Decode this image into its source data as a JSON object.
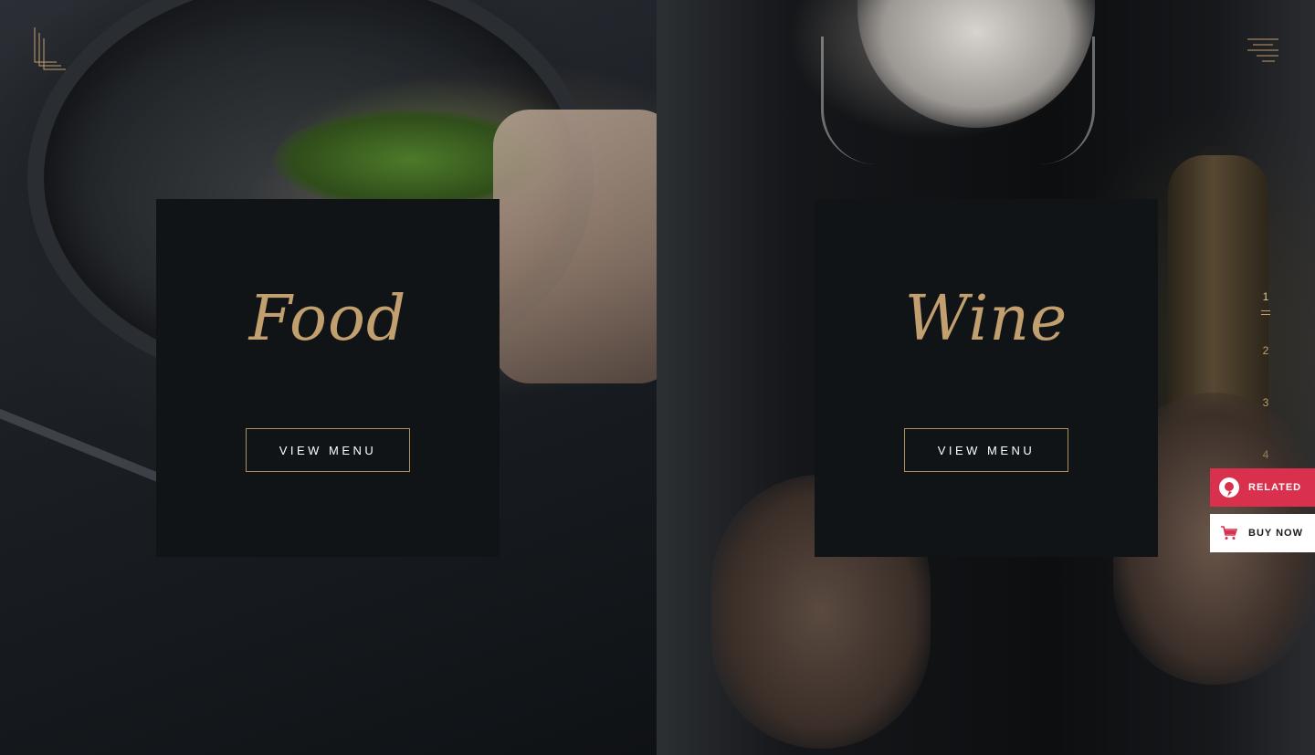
{
  "cards": [
    {
      "title": "Food",
      "button_label": "VIEW MENU"
    },
    {
      "title": "Wine",
      "button_label": "VIEW MENU"
    }
  ],
  "slider": {
    "pages": [
      "1",
      "2",
      "3",
      "4"
    ],
    "active": "1"
  },
  "side_buttons": {
    "related_label": "RELATED",
    "buy_label": "BUY NOW"
  },
  "icons": {
    "logo": "brand-logo-icon",
    "menu": "hamburger-menu-icon",
    "related": "related-circle-icon",
    "buy": "shopping-cart-icon"
  },
  "colors": {
    "accent_gold": "#c19f6e",
    "card_bg": "#111417",
    "related_bg": "#d9304d",
    "buy_bg": "#ffffff"
  }
}
